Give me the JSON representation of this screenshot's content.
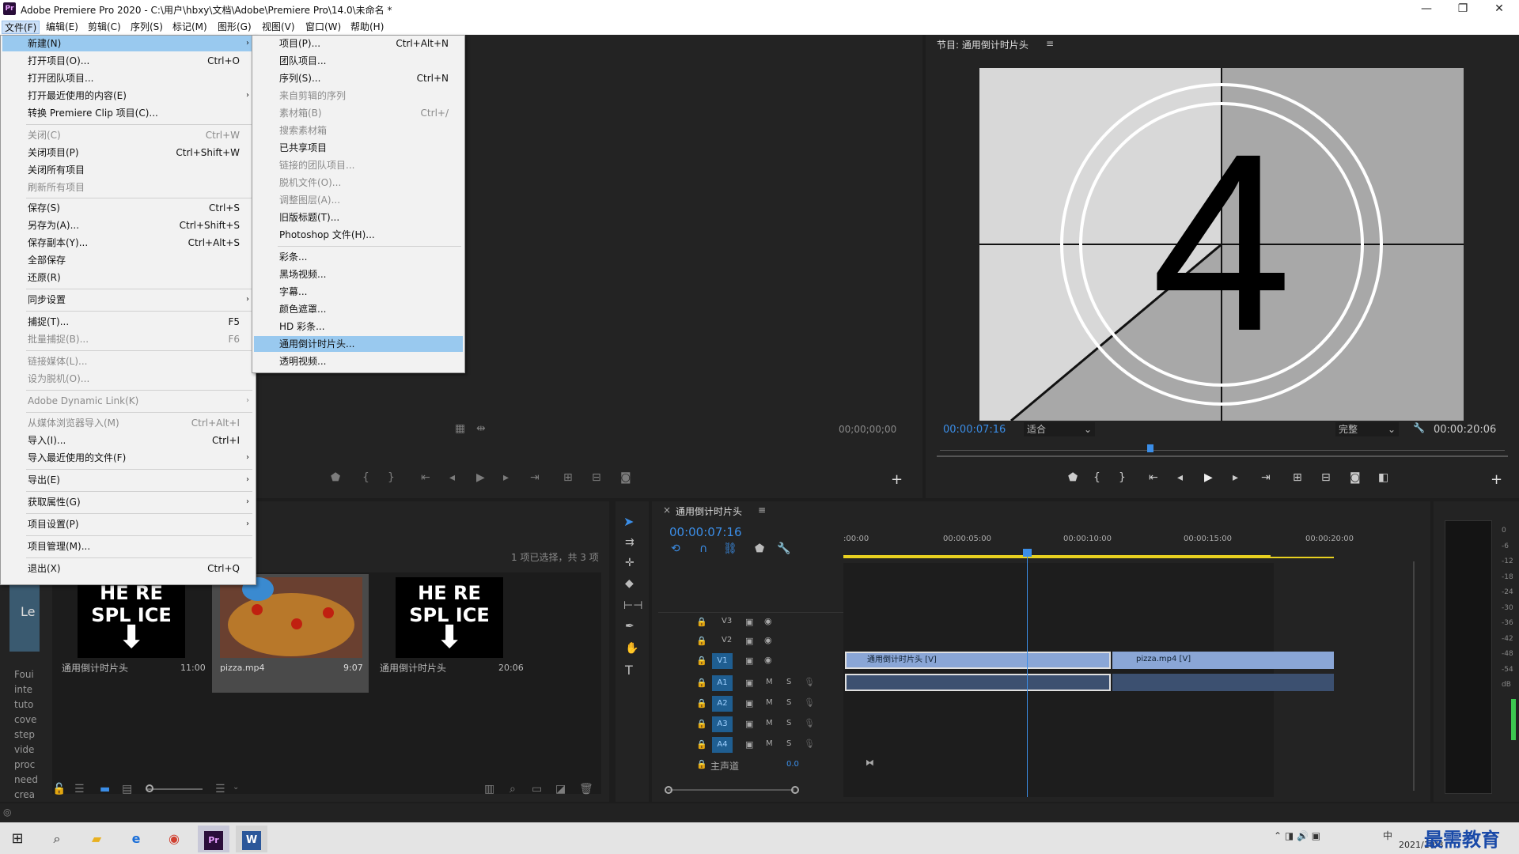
{
  "window": {
    "title": "Adobe Premiere Pro 2020 - C:\\用户\\hbxy\\文档\\Adobe\\Premiere Pro\\14.0\\未命名 *",
    "logo": "Pr"
  },
  "menubar": {
    "items": [
      "文件(F)",
      "编辑(E)",
      "剪辑(C)",
      "序列(S)",
      "标记(M)",
      "图形(G)",
      "视图(V)",
      "窗口(W)",
      "帮助(H)"
    ]
  },
  "file_menu": {
    "items": [
      {
        "label": "新建(N)",
        "shortcut": "",
        "submenu": true,
        "state": "highlighted"
      },
      {
        "label": "打开项目(O)...",
        "shortcut": "Ctrl+O"
      },
      {
        "label": "打开团队项目...",
        "shortcut": ""
      },
      {
        "label": "打开最近使用的内容(E)",
        "shortcut": "",
        "submenu": true
      },
      {
        "label": "转换 Premiere Clip 项目(C)...",
        "shortcut": ""
      },
      {
        "label": "关闭(C)",
        "shortcut": "Ctrl+W",
        "state": "disabled"
      },
      {
        "label": "关闭项目(P)",
        "shortcut": "Ctrl+Shift+W"
      },
      {
        "label": "关闭所有项目",
        "shortcut": ""
      },
      {
        "label": "刷新所有项目",
        "shortcut": "",
        "state": "disabled"
      },
      {
        "label": "保存(S)",
        "shortcut": "Ctrl+S"
      },
      {
        "label": "另存为(A)...",
        "shortcut": "Ctrl+Shift+S"
      },
      {
        "label": "保存副本(Y)...",
        "shortcut": "Ctrl+Alt+S"
      },
      {
        "label": "全部保存",
        "shortcut": ""
      },
      {
        "label": "还原(R)",
        "shortcut": ""
      },
      {
        "label": "同步设置",
        "shortcut": "",
        "submenu": true
      },
      {
        "label": "捕捉(T)...",
        "shortcut": "F5"
      },
      {
        "label": "批量捕捉(B)...",
        "shortcut": "F6",
        "state": "disabled"
      },
      {
        "label": "链接媒体(L)...",
        "shortcut": "",
        "state": "disabled"
      },
      {
        "label": "设为脱机(O)...",
        "shortcut": "",
        "state": "disabled"
      },
      {
        "label": "Adobe Dynamic Link(K)",
        "shortcut": "",
        "submenu": true,
        "state": "disabled"
      },
      {
        "label": "从媒体浏览器导入(M)",
        "shortcut": "Ctrl+Alt+I",
        "state": "disabled"
      },
      {
        "label": "导入(I)...",
        "shortcut": "Ctrl+I"
      },
      {
        "label": "导入最近使用的文件(F)",
        "shortcut": "",
        "submenu": true
      },
      {
        "label": "导出(E)",
        "shortcut": "",
        "submenu": true
      },
      {
        "label": "获取属性(G)",
        "shortcut": "",
        "submenu": true
      },
      {
        "label": "项目设置(P)",
        "shortcut": "",
        "submenu": true
      },
      {
        "label": "项目管理(M)...",
        "shortcut": ""
      },
      {
        "label": "退出(X)",
        "shortcut": "Ctrl+Q"
      }
    ]
  },
  "new_submenu": {
    "items": [
      {
        "label": "项目(P)...",
        "shortcut": "Ctrl+Alt+N"
      },
      {
        "label": "团队项目...",
        "shortcut": ""
      },
      {
        "label": "序列(S)...",
        "shortcut": "Ctrl+N"
      },
      {
        "label": "来自剪辑的序列",
        "shortcut": "",
        "state": "disabled"
      },
      {
        "label": "素材箱(B)",
        "shortcut": "Ctrl+/",
        "state": "disabled"
      },
      {
        "label": "搜索素材箱",
        "shortcut": "",
        "state": "disabled"
      },
      {
        "label": "已共享项目",
        "shortcut": ""
      },
      {
        "label": "链接的团队项目...",
        "shortcut": "",
        "state": "disabled"
      },
      {
        "label": "脱机文件(O)...",
        "shortcut": "",
        "state": "disabled"
      },
      {
        "label": "调整图层(A)...",
        "shortcut": "",
        "state": "disabled"
      },
      {
        "label": "旧版标题(T)...",
        "shortcut": ""
      },
      {
        "label": "Photoshop 文件(H)...",
        "shortcut": ""
      },
      {
        "label": "彩条...",
        "shortcut": ""
      },
      {
        "label": "黑场视频...",
        "shortcut": ""
      },
      {
        "label": "字幕...",
        "shortcut": ""
      },
      {
        "label": "颜色遮罩...",
        "shortcut": ""
      },
      {
        "label": "HD 彩条...",
        "shortcut": ""
      },
      {
        "label": "通用倒计时片头...",
        "shortcut": "",
        "state": "highlighted"
      },
      {
        "label": "透明视频...",
        "shortcut": ""
      }
    ]
  },
  "source_monitor": {
    "timecode": "00;00;00;00"
  },
  "program_monitor": {
    "title": "节目: 通用倒计时片头",
    "countdown_number": "4",
    "timecode": "00:00:07:16",
    "zoom": "适合",
    "quality": "完整",
    "duration": "00:00:20:06"
  },
  "project_panel": {
    "status": "1 项已选择，共 3 项",
    "items": [
      {
        "name": "通用倒计时片头",
        "duration": "11:00",
        "thumb": "countdown"
      },
      {
        "name": "pizza.mp4",
        "duration": "9:07",
        "thumb": "pizza",
        "selected": true
      },
      {
        "name": "通用倒计时片头",
        "duration": "20:06",
        "thumb": "countdown"
      }
    ],
    "thumb_text_top": "HE RE",
    "thumb_text_bottom": "SPL ICE",
    "side_text": [
      "Le",
      "Foui",
      "inte",
      "tuto",
      "cove",
      "step",
      "vide",
      "proc",
      "need",
      "crea"
    ]
  },
  "timeline": {
    "tab": "通用倒计时片头",
    "timecode": "00:00:07:16",
    "ruler": [
      ":00:00",
      "00:00:05:00",
      "00:00:10:00",
      "00:00:15:00",
      "00:00:20:00"
    ],
    "video_tracks": [
      "V3",
      "V2",
      "V1"
    ],
    "audio_tracks": [
      "A1",
      "A2",
      "A3",
      "A4"
    ],
    "master": "主声道",
    "master_value": "0.0",
    "clips": [
      {
        "label": "通用倒计时片头 [V]",
        "track": "V1"
      },
      {
        "label": "pizza.mp4 [V]",
        "track": "V1"
      }
    ],
    "track_buttons": {
      "mute": "M",
      "solo": "S"
    }
  },
  "audio_meter": {
    "scale": [
      "0",
      "-6",
      "-12",
      "-18",
      "-24",
      "-30",
      "-36",
      "-42",
      "-48",
      "-54",
      "dB"
    ]
  },
  "taskbar": {
    "time": "",
    "date": "2021/10/8",
    "ime": "中",
    "watermark": "最需教育"
  },
  "colors": {
    "accent": "#3b8ee8",
    "clip_video": "#8aa6d6",
    "menu_highlight": "#99c9ef",
    "track_button": "#1f5e91"
  }
}
